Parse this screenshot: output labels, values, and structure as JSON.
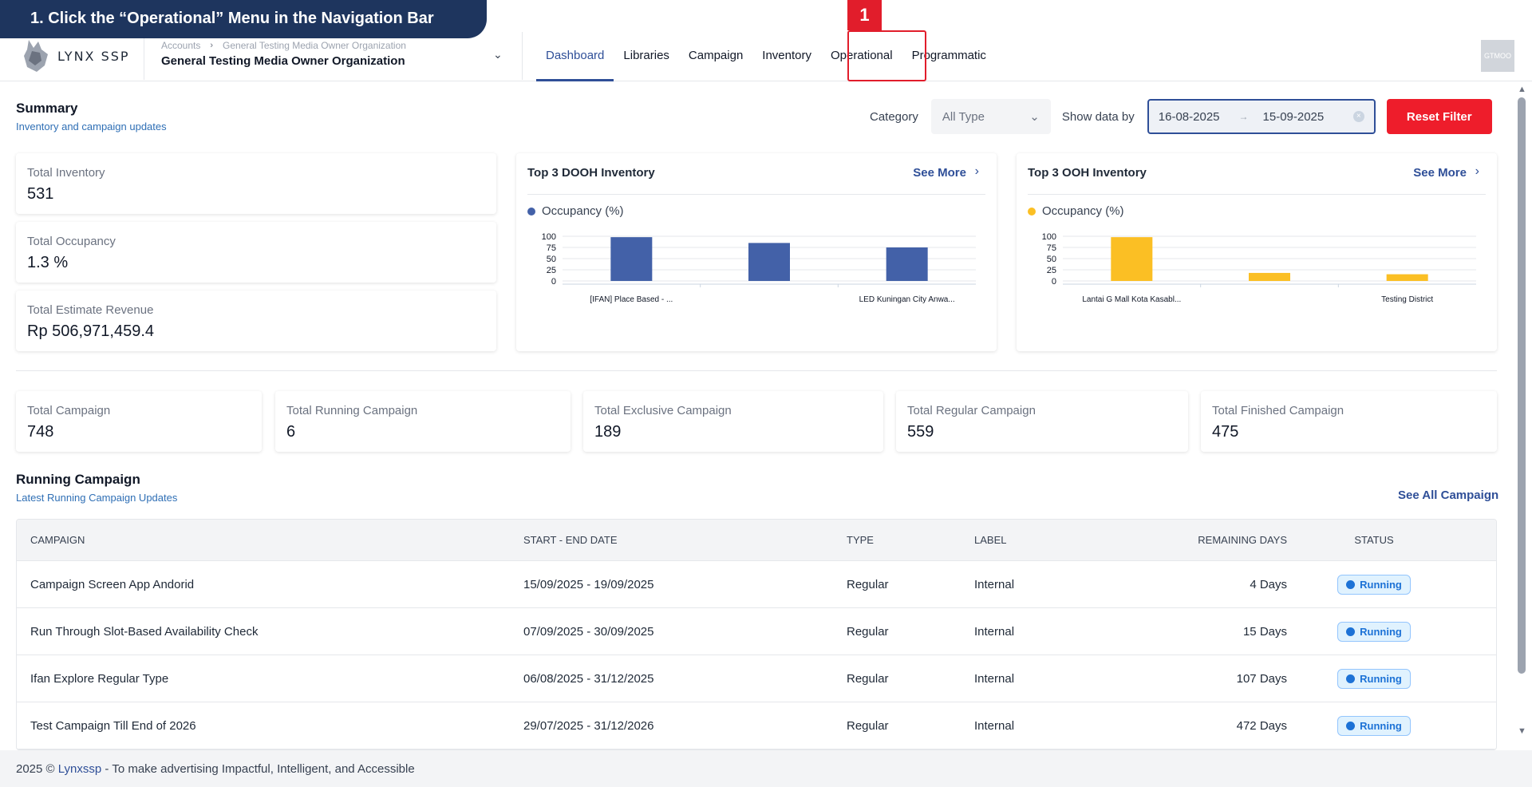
{
  "tutorial": {
    "banner": "1. Click the “Operational” Menu in the Navigation Bar",
    "step": "1"
  },
  "header": {
    "logo_text": "LYNX SSP",
    "breadcrumb": [
      "Accounts",
      "General Testing Media Owner Organization"
    ],
    "org_name": "General Testing Media Owner Organization",
    "nav": [
      "Dashboard",
      "Libraries",
      "Campaign",
      "Inventory",
      "Operational",
      "Programmatic"
    ],
    "avatar": "GTMOO"
  },
  "summary": {
    "title": "Summary",
    "subtitle": "Inventory and campaign updates",
    "category_label": "Category",
    "category_value": "All Type",
    "show_by_label": "Show data by",
    "date_from": "16-08-2025",
    "date_to": "15-09-2025",
    "reset_label": "Reset Filter"
  },
  "stats": [
    {
      "label": "Total Inventory",
      "value": "531"
    },
    {
      "label": "Total Occupancy",
      "value": "1.3 %"
    },
    {
      "label": "Total Estimate Revenue",
      "value": "Rp 506,971,459.4"
    }
  ],
  "dooh": {
    "title": "Top 3 DOOH Inventory",
    "see_more": "See More"
  },
  "ooh": {
    "title": "Top 3 OOH Inventory",
    "see_more": "See More"
  },
  "chart_data": [
    {
      "type": "bar",
      "title": "Top 3 DOOH Inventory",
      "series_name": "Occupancy (%)",
      "color": "#4361a8",
      "yticks": [
        "100",
        "75",
        "50",
        "25",
        "0"
      ],
      "ylim": [
        0,
        100
      ],
      "categories": [
        "[IFAN] Place Based - ...",
        "",
        "LED Kuningan City Anwa..."
      ],
      "values": [
        98,
        85,
        75
      ]
    },
    {
      "type": "bar",
      "title": "Top 3 OOH Inventory",
      "series_name": "Occupancy (%)",
      "color": "#fbbf24",
      "yticks": [
        "100",
        "75",
        "50",
        "25",
        "0"
      ],
      "ylim": [
        0,
        100
      ],
      "categories": [
        "Lantai G Mall Kota Kasabl...",
        "",
        "Testing District"
      ],
      "values": [
        98,
        18,
        15
      ]
    }
  ],
  "campaign_stats": [
    {
      "label": "Total Campaign",
      "value": "748"
    },
    {
      "label": "Total Running Campaign",
      "value": "6"
    },
    {
      "label": "Total Exclusive Campaign",
      "value": "189"
    },
    {
      "label": "Total Regular Campaign",
      "value": "559"
    },
    {
      "label": "Total Finished Campaign",
      "value": "475"
    }
  ],
  "running": {
    "title": "Running Campaign",
    "subtitle": "Latest Running Campaign Updates",
    "see_all": "See All Campaign",
    "headers": [
      "CAMPAIGN",
      "START - END DATE",
      "TYPE",
      "LABEL",
      "REMAINING DAYS",
      "STATUS"
    ],
    "rows": [
      {
        "campaign": "Campaign Screen App Andorid",
        "dates": "15/09/2025 - 19/09/2025",
        "type": "Regular",
        "label": "Internal",
        "remaining": "4 Days",
        "status": "Running"
      },
      {
        "campaign": "Run Through Slot-Based Availability Check",
        "dates": "07/09/2025 - 30/09/2025",
        "type": "Regular",
        "label": "Internal",
        "remaining": "15 Days",
        "status": "Running"
      },
      {
        "campaign": "Ifan Explore Regular Type",
        "dates": "06/08/2025 - 31/12/2025",
        "type": "Regular",
        "label": "Internal",
        "remaining": "107 Days",
        "status": "Running"
      },
      {
        "campaign": "Test Campaign Till End of 2026",
        "dates": "29/07/2025 - 31/12/2026",
        "type": "Regular",
        "label": "Internal",
        "remaining": "472 Days",
        "status": "Running"
      }
    ]
  },
  "footer": {
    "year": "2025 ©",
    "brand": "Lynxssp",
    "tagline": "- To make advertising Impactful, Intelligent, and Accessible"
  },
  "colors": {
    "primary": "#2f4f98",
    "danger": "#ee1d2b",
    "dooh": "#4361a8",
    "ooh": "#fbbf24",
    "tutorial_bg": "#1e355e"
  }
}
